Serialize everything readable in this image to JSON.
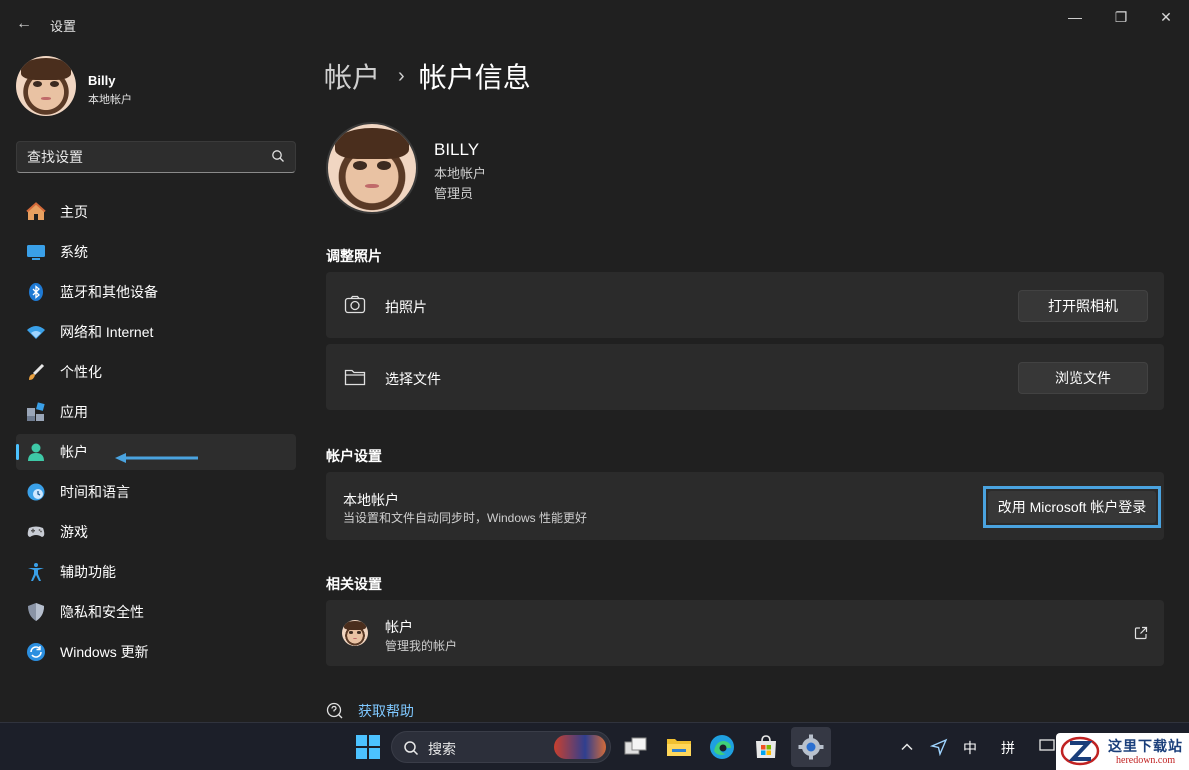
{
  "titlebar": {
    "title": "设置",
    "back_glyph": "←",
    "min_glyph": "—",
    "max_glyph": "❐",
    "close_glyph": "✕"
  },
  "user": {
    "name": "Billy",
    "type": "本地帐户"
  },
  "sidebar_search": {
    "placeholder": "查找设置",
    "icon": "search-icon"
  },
  "nav": [
    {
      "label": "主页",
      "icon": "home-icon",
      "active": false
    },
    {
      "label": "系统",
      "icon": "system-icon",
      "active": false
    },
    {
      "label": "蓝牙和其他设备",
      "icon": "bluetooth-icon",
      "active": false
    },
    {
      "label": "网络和 Internet",
      "icon": "wifi-icon",
      "active": false
    },
    {
      "label": "个性化",
      "icon": "brush-icon",
      "active": false
    },
    {
      "label": "应用",
      "icon": "apps-icon",
      "active": false
    },
    {
      "label": "帐户",
      "icon": "account-icon",
      "active": true
    },
    {
      "label": "时间和语言",
      "icon": "clock-icon",
      "active": false
    },
    {
      "label": "游戏",
      "icon": "gamepad-icon",
      "active": false
    },
    {
      "label": "辅助功能",
      "icon": "accessibility-icon",
      "active": false
    },
    {
      "label": "隐私和安全性",
      "icon": "shield-icon",
      "active": false
    },
    {
      "label": "Windows 更新",
      "icon": "update-icon",
      "active": false
    }
  ],
  "breadcrumb": {
    "parent": "帐户",
    "separator": "›",
    "current": "帐户信息"
  },
  "profile": {
    "name": "BILLY",
    "account_type": "本地帐户",
    "role": "管理员"
  },
  "adjust_photo": {
    "title": "调整照片",
    "take_photo": {
      "label": "拍照片",
      "button": "打开照相机"
    },
    "choose_file": {
      "label": "选择文件",
      "button": "浏览文件"
    }
  },
  "account_settings": {
    "title": "帐户设置",
    "local": {
      "label": "本地帐户",
      "description": "当设置和文件自动同步时，Windows 性能更好",
      "button": "改用 Microsoft 帐户登录"
    }
  },
  "related": {
    "title": "相关设置",
    "account": {
      "label": "帐户",
      "description": "管理我的帐户"
    }
  },
  "help": {
    "label": "获取帮助"
  },
  "taskbar": {
    "search_label": "搜索",
    "tray_ime_mode": "中",
    "tray_ime_pinyin": "拼"
  },
  "watermark": {
    "cn": "这里下载站",
    "en": "heredown.com"
  },
  "colors": {
    "accent": "#4cc2ff",
    "link": "#7fc8ff",
    "annotation": "#4aa3df",
    "background": "#202020",
    "card": "#2b2b2b"
  }
}
